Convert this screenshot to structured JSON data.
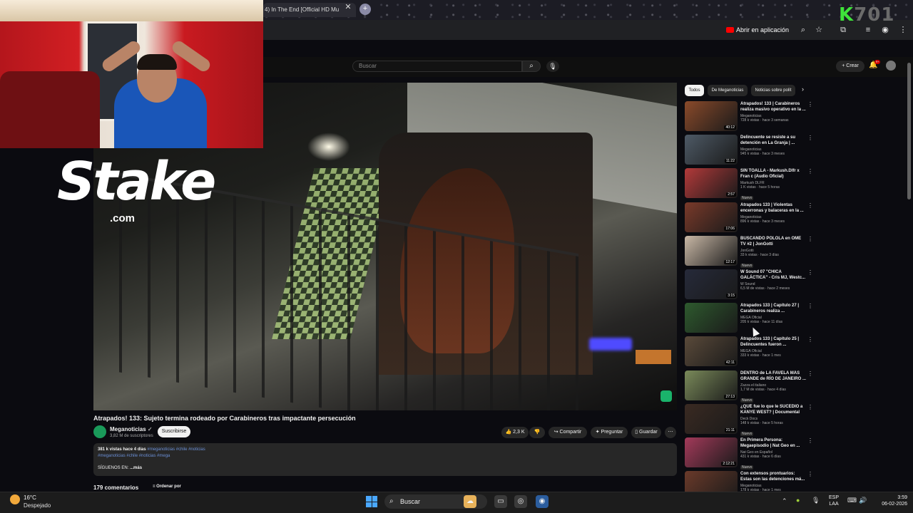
{
  "browser": {
    "tab_title": "4) In The End [Official HD Mu",
    "open_in_app": "Abrir en aplicación"
  },
  "stream_overlay": {
    "brand": "Stake",
    "brand_sub": ".com",
    "channel_tag_k": "K",
    "channel_tag_rest": "701"
  },
  "youtube": {
    "search_placeholder": "Buscar",
    "create_label": "Crear",
    "notif_count": "9+",
    "video": {
      "title": "Atrapados! 133: Sujeto termina rodeado por Carabineros tras impactante persecución",
      "channel": "Meganoticias",
      "subscribers": "3,82 M de suscriptores",
      "subscribe_label": "Suscribirse",
      "likes": "2,3 K",
      "share_label": "Compartir",
      "ask_label": "Preguntar",
      "save_label": "Guardar",
      "desc_stats": "381 k vistas  hace 4 días",
      "desc_tags_line1": "#meganoticias #chile #noticias",
      "desc_tags_line2": "#meganoticias #chile #noticias #mega",
      "desc_follow": "SÍGUENOS EN:",
      "desc_more": "...más",
      "comments_count": "179 comentarios",
      "sort_label": "Ordenar por"
    },
    "chips": [
      "Todos",
      "De Meganoticias",
      "Noticias sobre polít"
    ],
    "recommendations": [
      {
        "title": "Atrapados! 133 | Carabineros realiza masivo operativo en la ...",
        "channel": "Meganoticias",
        "stats": "728 k vistas · hace 3 semanas",
        "duration": "40:12",
        "badge": ""
      },
      {
        "title": "Delincuente se resiste a su detención en La Granja | ...",
        "channel": "Meganoticias",
        "stats": "945 k vistas · hace 3 meses",
        "duration": "11:22",
        "badge": ""
      },
      {
        "title": "SIN TOALLA - Markush.Dlfr x Fran c (Audio Oficial)",
        "channel": "Markush DLFR",
        "stats": "1 K vistas · hace 5 horas",
        "duration": "2:57",
        "badge": "Nuevo"
      },
      {
        "title": "Atrapados 133 | Violentas encerronas y balaceras en la ...",
        "channel": "Meganoticias",
        "stats": "896 k vistas · hace 3 meses",
        "duration": "17:06",
        "badge": ""
      },
      {
        "title": "BUSCANDO POLOLA en OME TV #2 | JonGotti",
        "channel": "JonGotti",
        "stats": "33 k vistas · hace 3 días",
        "duration": "12:17",
        "badge": "Nuevo"
      },
      {
        "title": "W Sound 07 \"CHICA GALÁCTICA\" - Cris MJ, Westc...",
        "channel": "W Sound",
        "stats": "6,5 M de vistas · hace 2 meses",
        "duration": "3:15",
        "badge": ""
      },
      {
        "title": "Atrapados 133 | Capítulo 27 | Carabineros realiza ...",
        "channel": "MEGA Oficial",
        "stats": "205 k vistas · hace 11 días",
        "duration": "",
        "badge": ""
      },
      {
        "title": "Atrapados 133 | Capítulo 25 | Delincuentes fueron ...",
        "channel": "MEGA Oficial",
        "stats": "333 k vistas · hace 1 mes",
        "duration": "42:11",
        "badge": ""
      },
      {
        "title": "DENTRO de LA FAVELA MÁS GRANDE de RÍO DE JANEIRO ...",
        "channel": "Zazza el italiano",
        "stats": "1,7 M de vistas · hace 4 días",
        "duration": "27:13",
        "badge": "Nuevo"
      },
      {
        "title": "¿QUÉ fue lo que le SUCEDIÓ a KANYE WEST? | Documental",
        "channel": "Deck Docs",
        "stats": "148 k vistas · hace 5 horas",
        "duration": "21:11",
        "badge": "Nuevo"
      },
      {
        "title": "En Primera Persona: Megaepisodio | Nat Geo en ...",
        "channel": "Nat Geo en Español",
        "stats": "431 k vistas · hace 6 días",
        "duration": "2:12:21",
        "badge": "Nuevo"
      },
      {
        "title": "Con extensos prontuarios: Estas son las detenciones má...",
        "channel": "Meganoticias",
        "stats": "178 k vistas · hace 1 mes",
        "duration": "",
        "badge": ""
      }
    ]
  },
  "taskbar": {
    "temp": "16°C",
    "weather": "Despejado",
    "search_label": "Buscar",
    "lang_1": "ESP",
    "lang_2": "LAA",
    "time": "3:59",
    "date": "06-02-2026"
  },
  "colors": {
    "youtube_bg": "#0f0f0f",
    "accent_red": "#ff0000",
    "tag_blue": "#6b8fd6",
    "k701_green": "#3ee33a"
  }
}
